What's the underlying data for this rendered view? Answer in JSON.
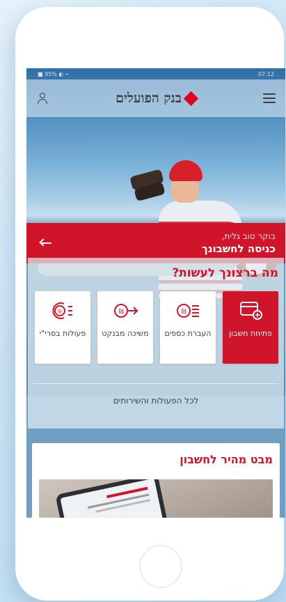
{
  "app": {
    "bank_name": "בנק הפועלים",
    "brand_color": "#d0152b"
  },
  "header": {
    "menu_icon": "hamburger-icon",
    "user_icon": "user-icon"
  },
  "status_bar": {
    "left": "■ 95% ◐ ⌁",
    "right": "07:12"
  },
  "welcome": {
    "greeting": "בוקר טוב גלית,",
    "login_label": "כניסה לחשבונך",
    "arrow_icon": "arrow-left-icon"
  },
  "actions": {
    "question": "מה ברצונך לעשות?",
    "tiles": [
      {
        "label": "פתיחת חשבון",
        "icon": "open-account-icon",
        "active": true
      },
      {
        "label": "העברת כספים",
        "icon": "money-transfer-icon",
        "active": false
      },
      {
        "label": "משיכה מבנקט",
        "icon": "atm-withdrawal-icon",
        "active": false
      },
      {
        "label": "פעולות בסרי\"י",
        "icon": "transactions-icon",
        "active": false
      }
    ],
    "all_services": "לכל הפעולות והשירותים"
  },
  "quick_view": {
    "title": "מבט מהיר לחשבון"
  }
}
